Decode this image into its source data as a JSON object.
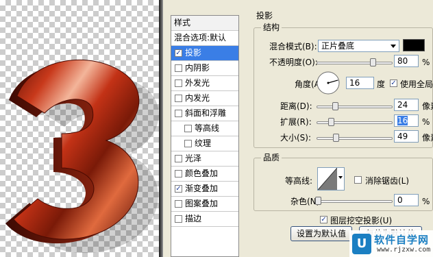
{
  "canvas": {
    "digit_glyph": "3",
    "digit_color": "#b8301a"
  },
  "styles_panel": {
    "title": "样式",
    "items": [
      {
        "label": "混合选项:默认",
        "kind": "header"
      },
      {
        "label": "投影",
        "checked": true,
        "selected": true
      },
      {
        "label": "内阴影",
        "checked": false
      },
      {
        "label": "外发光",
        "checked": false
      },
      {
        "label": "内发光",
        "checked": false
      },
      {
        "label": "斜面和浮雕",
        "checked": false
      },
      {
        "label": "等高线",
        "checked": false,
        "sub": true
      },
      {
        "label": "纹理",
        "checked": false,
        "sub": true
      },
      {
        "label": "光泽",
        "checked": false
      },
      {
        "label": "颜色叠加",
        "checked": false
      },
      {
        "label": "渐变叠加",
        "checked": true
      },
      {
        "label": "图案叠加",
        "checked": false
      },
      {
        "label": "描边",
        "checked": false
      }
    ]
  },
  "drop_shadow": {
    "section_title": "投影",
    "structure_title": "结构",
    "blend_mode_label": "混合模式(B):",
    "blend_mode_value": "正片叠底",
    "blend_color": "#000000",
    "opacity_label": "不透明度(O):",
    "opacity_value": "80",
    "opacity_unit": "%",
    "angle_label": "角度(A):",
    "angle_value": "16",
    "angle_unit": "度",
    "global_light_label": "使用全局",
    "global_light_checked": true,
    "distance_label": "距离(D):",
    "distance_value": "24",
    "distance_unit": "像素",
    "spread_label": "扩展(R):",
    "spread_value": "16",
    "spread_unit": "%",
    "size_label": "大小(S):",
    "size_value": "49",
    "size_unit": "像素",
    "quality_title": "品质",
    "contour_label": "等高线:",
    "anti_alias_label": "消除锯齿(L)",
    "anti_alias_checked": false,
    "noise_label": "杂色(N):",
    "noise_value": "0",
    "noise_unit": "%",
    "knockout_label": "图层挖空投影(U)",
    "knockout_checked": true,
    "set_default_label": "设置为默认值",
    "reset_default_label": "复位为默认值"
  },
  "watermark": {
    "logo_letter": "U",
    "title": "软件自学网",
    "url": "www.rjzxw.com"
  }
}
